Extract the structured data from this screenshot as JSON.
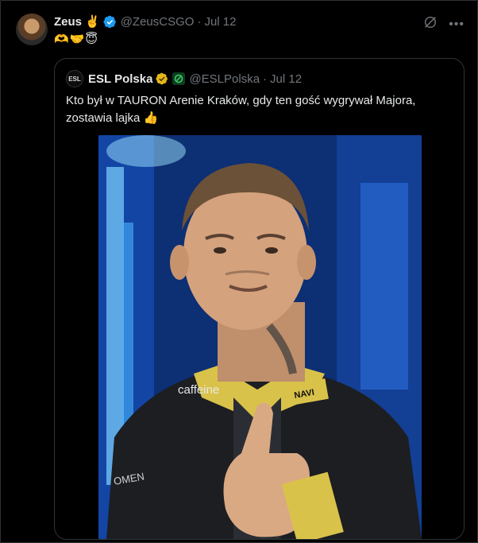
{
  "tweet": {
    "author_name": "Zeus",
    "author_emoji": "✌️",
    "handle": "@ZeusCSGO",
    "separator": "·",
    "date": "Jul 12",
    "text_emoji": "🫶🤝😇",
    "icons": [
      "grok-icon",
      "more-icon"
    ]
  },
  "quote": {
    "author_name": "ESL Polska",
    "logo_text": "ESL",
    "handle": "@ESLPolska",
    "separator": "·",
    "date": "Jul 12",
    "text": "Kto był w TAURON Arenie Kraków, gdy ten gość wygrywał Majora, zostawia lajka 👍",
    "media": {
      "jersey_sponsor": "caffeine",
      "jersey_brand": "OMEN",
      "badge_text": "NAVI"
    }
  },
  "colors": {
    "background": "#000000",
    "text": "#e7e9ea",
    "muted": "#71767b",
    "verified_blue": "#1d9bf0",
    "gold_badge": "#e2b719",
    "border": "#2f3336"
  }
}
